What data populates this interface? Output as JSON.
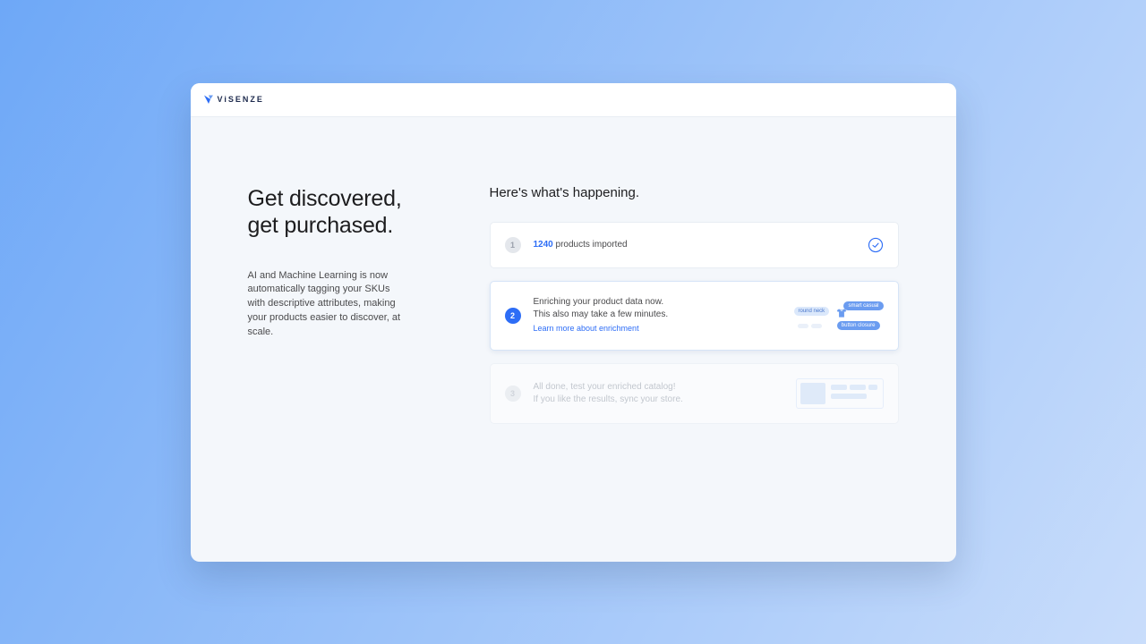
{
  "brand": {
    "name": "ViSENZE"
  },
  "hero": {
    "headline_l1": "Get discovered,",
    "headline_l2": "get purchased.",
    "subcopy": "AI and Machine Learning is now automatically tagging your SKUs with descriptive attributes, making your products easier to discover, at scale."
  },
  "status": {
    "heading": "Here's what's happening.",
    "step1": {
      "number": "1",
      "count": "1240",
      "label": "products imported"
    },
    "step2": {
      "number": "2",
      "line1": "Enriching your product data now.",
      "line2": "This also may take a few minutes.",
      "link": "Learn more about enrichment",
      "tags": {
        "t1": "round neck",
        "t2": "smart casual",
        "t3": "button closure"
      }
    },
    "step3": {
      "number": "3",
      "line1": "All done, test your enriched catalog!",
      "line2": "If you like the results, sync your store."
    }
  }
}
